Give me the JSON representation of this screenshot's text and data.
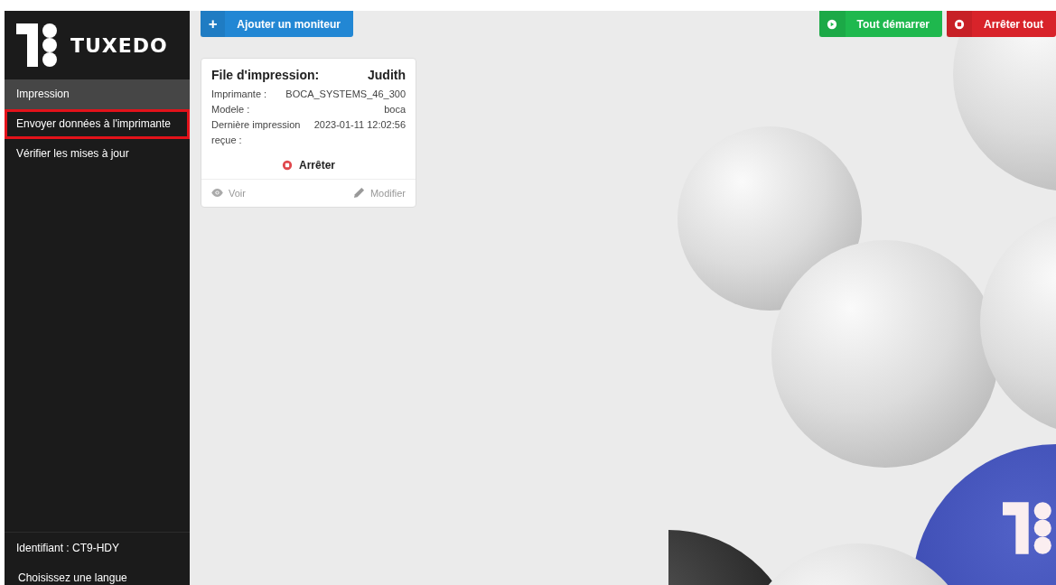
{
  "sidebar": {
    "logo": "TUXEDO",
    "items": [
      {
        "label": "Impression",
        "selected": true,
        "outlined": false
      },
      {
        "label": "Envoyer données à l'imprimante",
        "selected": false,
        "outlined": true
      },
      {
        "label": "Vérifier les mises à jour",
        "selected": false,
        "outlined": false
      }
    ],
    "identifier": "Identifiant : CT9-HDY",
    "language": "Choisissez une langue"
  },
  "toolbar": {
    "add_button": {
      "icon": "+",
      "label": "Ajouter un moniteur"
    },
    "actions": [
      {
        "kind": "start",
        "label": "Tout démarrer"
      },
      {
        "kind": "stop",
        "label": "Arrêter tout"
      }
    ]
  },
  "monitors": [
    {
      "title": "File d'impression:",
      "name": "Judith",
      "fields": [
        {
          "label": "Imprimante :",
          "value": "BOCA_SYSTEMS_46_300"
        },
        {
          "label": "Modele :",
          "value": "boca"
        },
        {
          "label": "Dernière impression reçue :",
          "value": "2023-01-11 12:02:56"
        }
      ],
      "action": {
        "kind": "stop",
        "label": "Arrêter"
      },
      "view": "Voir",
      "edit": "Modifier"
    }
  ]
}
